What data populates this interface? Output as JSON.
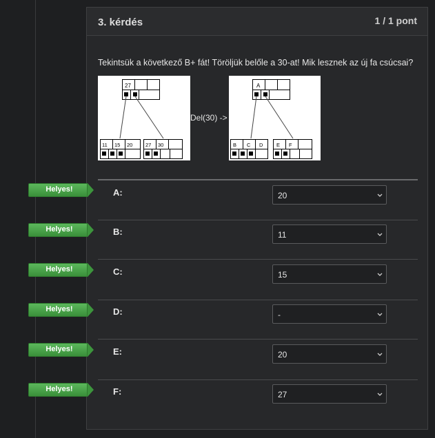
{
  "question": {
    "title": "3. kérdés",
    "points": "1 / 1 pont",
    "prompt": "Tekintsük a következő B+ fát! Töröljük belőle a 30-at! Mik lesznek az új fa csúcsai?",
    "del_label": "Del(30) ->"
  },
  "tree_before": {
    "root_key": "27",
    "leaf1_keys": [
      "11",
      "15",
      "20"
    ],
    "leaf2_keys": [
      "27",
      "30"
    ]
  },
  "tree_after": {
    "root_key": "A",
    "leaf1_keys": [
      "B",
      "C",
      "D"
    ],
    "leaf2_keys": [
      "E",
      "F"
    ]
  },
  "colors": {
    "correct": "#4cae4c",
    "background": "#1e1f21",
    "card": "#27282a"
  },
  "answers": [
    {
      "label": "A:",
      "value": "20",
      "status": "Helyes!"
    },
    {
      "label": "B:",
      "value": "11",
      "status": "Helyes!"
    },
    {
      "label": "C:",
      "value": "15",
      "status": "Helyes!"
    },
    {
      "label": "D:",
      "value": "-",
      "status": "Helyes!"
    },
    {
      "label": "E:",
      "value": "20",
      "status": "Helyes!"
    },
    {
      "label": "F:",
      "value": "27",
      "status": "Helyes!"
    }
  ]
}
